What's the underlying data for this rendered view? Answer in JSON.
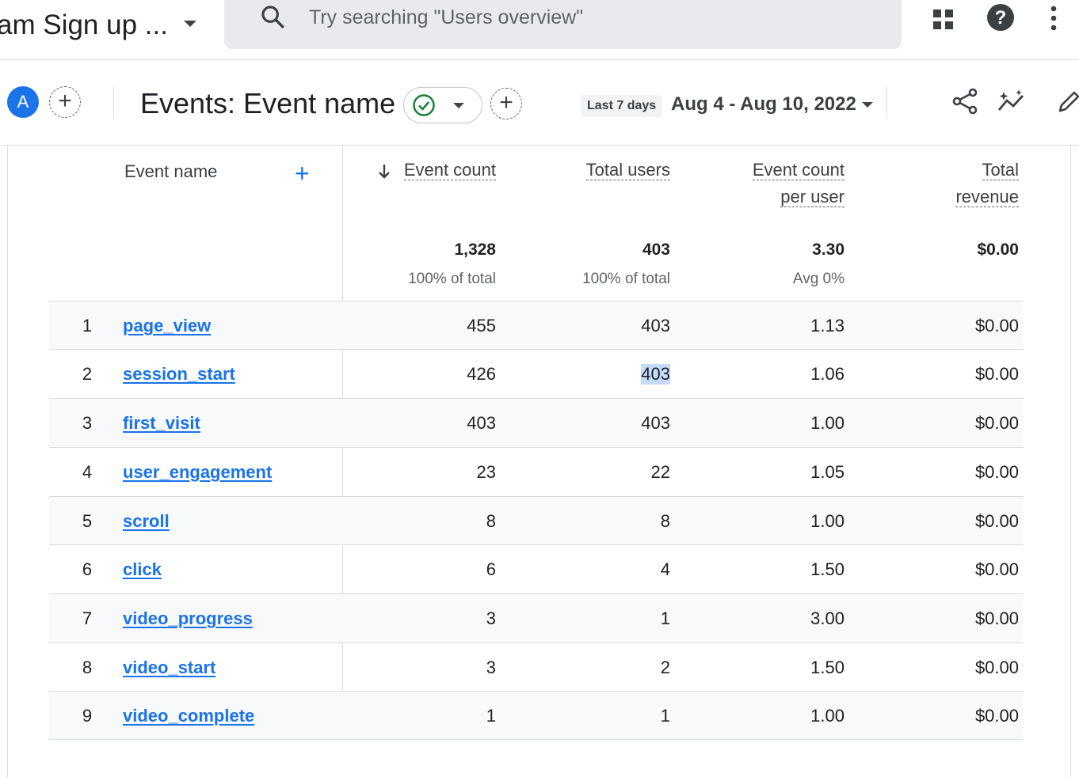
{
  "topbar": {
    "property_name": "am Sign up ...",
    "search_placeholder": "Try searching \"Users overview\""
  },
  "report_header": {
    "avatar_letter": "A",
    "title": "Events: Event name",
    "date_chip": "Last 7 days",
    "date_range": "Aug 4 - Aug 10, 2022"
  },
  "table": {
    "dimension_header": "Event name",
    "columns": [
      {
        "label_line1": "Event count",
        "label_line2": "",
        "total": "1,328",
        "total_sub": "100% of total"
      },
      {
        "label_line1": "Total users",
        "label_line2": "",
        "total": "403",
        "total_sub": "100% of total"
      },
      {
        "label_line1": "Event count",
        "label_line2": "per user",
        "total": "3.30",
        "total_sub": "Avg 0%"
      },
      {
        "label_line1": "Total",
        "label_line2": "revenue",
        "total": "$0.00",
        "total_sub": ""
      }
    ],
    "rows": [
      {
        "idx": "1",
        "name": "page_view",
        "event_count": "455",
        "total_users": "403",
        "per_user": "1.13",
        "revenue": "$0.00"
      },
      {
        "idx": "2",
        "name": "session_start",
        "event_count": "426",
        "total_users": "403",
        "per_user": "1.06",
        "revenue": "$0.00"
      },
      {
        "idx": "3",
        "name": "first_visit",
        "event_count": "403",
        "total_users": "403",
        "per_user": "1.00",
        "revenue": "$0.00"
      },
      {
        "idx": "4",
        "name": "user_engagement",
        "event_count": "23",
        "total_users": "22",
        "per_user": "1.05",
        "revenue": "$0.00"
      },
      {
        "idx": "5",
        "name": "scroll",
        "event_count": "8",
        "total_users": "8",
        "per_user": "1.00",
        "revenue": "$0.00"
      },
      {
        "idx": "6",
        "name": "click",
        "event_count": "6",
        "total_users": "4",
        "per_user": "1.50",
        "revenue": "$0.00"
      },
      {
        "idx": "7",
        "name": "video_progress",
        "event_count": "3",
        "total_users": "1",
        "per_user": "3.00",
        "revenue": "$0.00"
      },
      {
        "idx": "8",
        "name": "video_start",
        "event_count": "3",
        "total_users": "2",
        "per_user": "1.50",
        "revenue": "$0.00"
      },
      {
        "idx": "9",
        "name": "video_complete",
        "event_count": "1",
        "total_users": "1",
        "per_user": "1.00",
        "revenue": "$0.00"
      }
    ]
  }
}
